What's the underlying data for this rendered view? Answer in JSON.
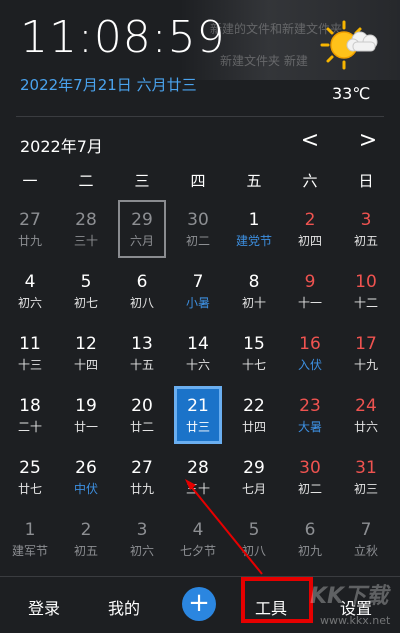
{
  "header": {
    "time": "11:08:59",
    "date_line": "2022年7月21日 六月廿三",
    "temperature": "33℃",
    "weather_icon": "sunny-cloud-icon"
  },
  "background_ghost": {
    "line1": "新建的文件和新建文件夹",
    "line2": "新建文件夹   新建   "
  },
  "calendar": {
    "month_title": "2022年7月",
    "prev_label": "<",
    "next_label": ">",
    "weekdays": [
      "一",
      "二",
      "三",
      "四",
      "五",
      "六",
      "日"
    ],
    "rows": [
      [
        {
          "day": "27",
          "lunar": "廿九",
          "out": true
        },
        {
          "day": "28",
          "lunar": "三十",
          "out": true
        },
        {
          "day": "29",
          "lunar": "六月",
          "out": true,
          "outlined": true
        },
        {
          "day": "30",
          "lunar": "初二",
          "out": true
        },
        {
          "day": "1",
          "lunar": "建党节",
          "day_color": "white",
          "lunar_color": "blue"
        },
        {
          "day": "2",
          "lunar": "初四",
          "day_color": "red",
          "lunar_color": "normal"
        },
        {
          "day": "3",
          "lunar": "初五",
          "day_color": "red",
          "lunar_color": "normal"
        }
      ],
      [
        {
          "day": "4",
          "lunar": "初六",
          "day_color": "white",
          "lunar_color": "normal"
        },
        {
          "day": "5",
          "lunar": "初七",
          "day_color": "white",
          "lunar_color": "normal"
        },
        {
          "day": "6",
          "lunar": "初八",
          "day_color": "white",
          "lunar_color": "normal"
        },
        {
          "day": "7",
          "lunar": "小暑",
          "day_color": "white",
          "lunar_color": "blue"
        },
        {
          "day": "8",
          "lunar": "初十",
          "day_color": "white",
          "lunar_color": "normal"
        },
        {
          "day": "9",
          "lunar": "十一",
          "day_color": "red",
          "lunar_color": "normal"
        },
        {
          "day": "10",
          "lunar": "十二",
          "day_color": "red",
          "lunar_color": "normal"
        }
      ],
      [
        {
          "day": "11",
          "lunar": "十三",
          "day_color": "white",
          "lunar_color": "normal"
        },
        {
          "day": "12",
          "lunar": "十四",
          "day_color": "white",
          "lunar_color": "normal"
        },
        {
          "day": "13",
          "lunar": "十五",
          "day_color": "white",
          "lunar_color": "normal"
        },
        {
          "day": "14",
          "lunar": "十六",
          "day_color": "white",
          "lunar_color": "normal"
        },
        {
          "day": "15",
          "lunar": "十七",
          "day_color": "white",
          "lunar_color": "normal"
        },
        {
          "day": "16",
          "lunar": "入伏",
          "day_color": "red",
          "lunar_color": "blue"
        },
        {
          "day": "17",
          "lunar": "十九",
          "day_color": "red",
          "lunar_color": "normal"
        }
      ],
      [
        {
          "day": "18",
          "lunar": "二十",
          "day_color": "white",
          "lunar_color": "normal"
        },
        {
          "day": "19",
          "lunar": "廿一",
          "day_color": "white",
          "lunar_color": "normal"
        },
        {
          "day": "20",
          "lunar": "廿二",
          "day_color": "white",
          "lunar_color": "normal"
        },
        {
          "day": "21",
          "lunar": "廿三",
          "day_color": "white",
          "lunar_color": "normal",
          "today": true
        },
        {
          "day": "22",
          "lunar": "廿四",
          "day_color": "white",
          "lunar_color": "normal"
        },
        {
          "day": "23",
          "lunar": "大暑",
          "day_color": "red",
          "lunar_color": "blue"
        },
        {
          "day": "24",
          "lunar": "廿六",
          "day_color": "red",
          "lunar_color": "normal"
        }
      ],
      [
        {
          "day": "25",
          "lunar": "廿七",
          "day_color": "white",
          "lunar_color": "normal"
        },
        {
          "day": "26",
          "lunar": "中伏",
          "day_color": "white",
          "lunar_color": "blue"
        },
        {
          "day": "27",
          "lunar": "廿九",
          "day_color": "white",
          "lunar_color": "normal"
        },
        {
          "day": "28",
          "lunar": "三十",
          "day_color": "white",
          "lunar_color": "normal"
        },
        {
          "day": "29",
          "lunar": "七月",
          "day_color": "white",
          "lunar_color": "normal"
        },
        {
          "day": "30",
          "lunar": "初二",
          "day_color": "red",
          "lunar_color": "normal"
        },
        {
          "day": "31",
          "lunar": "初三",
          "day_color": "red",
          "lunar_color": "normal"
        }
      ],
      [
        {
          "day": "1",
          "lunar": "建军节",
          "out": true
        },
        {
          "day": "2",
          "lunar": "初五",
          "out": true
        },
        {
          "day": "3",
          "lunar": "初六",
          "out": true
        },
        {
          "day": "4",
          "lunar": "七夕节",
          "out": true
        },
        {
          "day": "5",
          "lunar": "初八",
          "out": true
        },
        {
          "day": "6",
          "lunar": "初九",
          "out": true
        },
        {
          "day": "7",
          "lunar": "立秋",
          "out": true
        }
      ]
    ]
  },
  "bottom_bar": {
    "login_label": "登录",
    "mine_label": "我的",
    "add_label": "+",
    "tools_label": "工具",
    "settings_label": "设置"
  },
  "watermark": {
    "logo": "KK下载",
    "url": "www.kkx.net"
  },
  "colors": {
    "background": "#1d1f22",
    "accent_blue": "#2b86e0",
    "today_fill": "#1b73c9",
    "weekend_red": "#ef5350",
    "festival_blue": "#3d8fe0",
    "annotation_red": "#e60000"
  }
}
